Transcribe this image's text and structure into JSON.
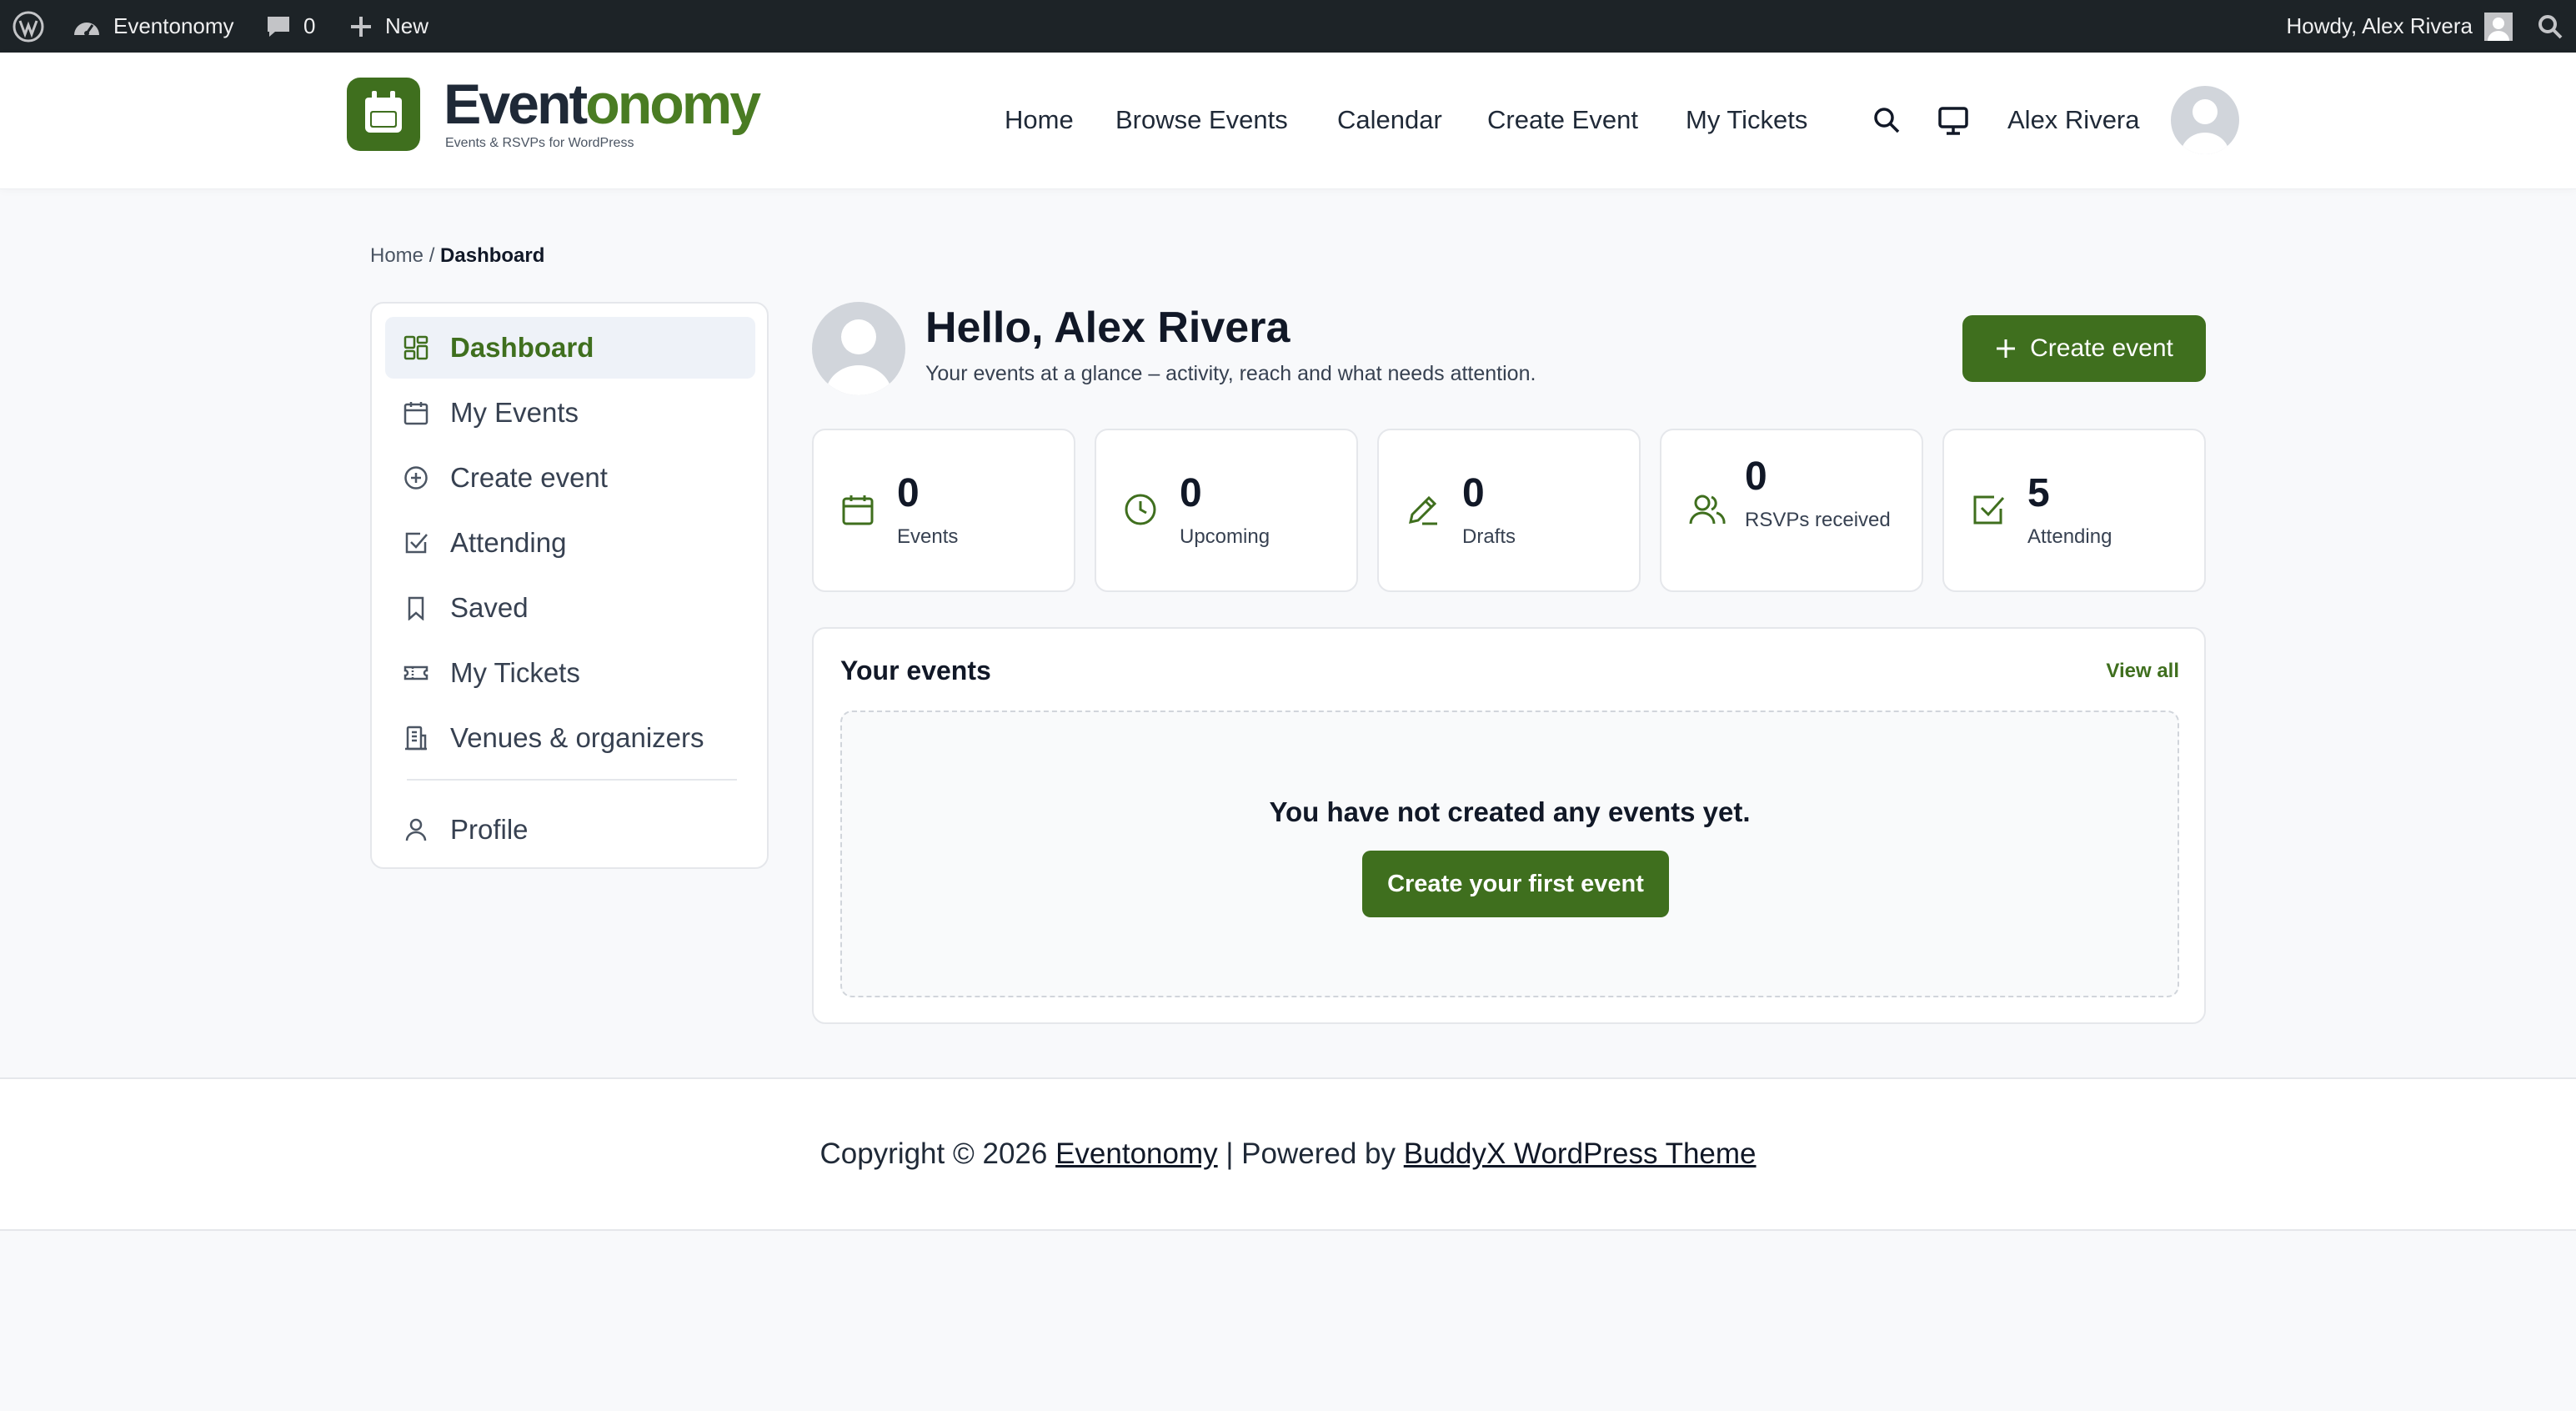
{
  "admin_bar": {
    "site_name": "Eventonomy",
    "comments_count": "0",
    "new_label": "New",
    "howdy": "Howdy, Alex Rivera"
  },
  "header": {
    "logo_part1": "Event",
    "logo_part2": "onomy",
    "tagline": "Events & RSVPs for WordPress",
    "nav": [
      "Home",
      "Browse Events",
      "Calendar",
      "Create Event",
      "My Tickets"
    ],
    "user_name": "Alex Rivera"
  },
  "breadcrumb": {
    "home": "Home",
    "separator": "/",
    "current": "Dashboard"
  },
  "sidebar": {
    "items": [
      {
        "label": "Dashboard",
        "icon": "dashboard-grid-icon"
      },
      {
        "label": "My Events",
        "icon": "calendar-icon"
      },
      {
        "label": "Create event",
        "icon": "plus-circle-icon"
      },
      {
        "label": "Attending",
        "icon": "check-square-icon"
      },
      {
        "label": "Saved",
        "icon": "bookmark-icon"
      },
      {
        "label": "My Tickets",
        "icon": "ticket-icon"
      },
      {
        "label": "Venues & organizers",
        "icon": "building-icon"
      }
    ],
    "profile": {
      "label": "Profile",
      "icon": "user-icon"
    }
  },
  "greeting": {
    "title": "Hello, Alex Rivera",
    "subtitle": "Your events at a glance – activity, reach and what needs attention.",
    "create_button": "Create event"
  },
  "stats": [
    {
      "value": "0",
      "label": "Events",
      "icon": "calendar-icon"
    },
    {
      "value": "0",
      "label": "Upcoming",
      "icon": "clock-icon"
    },
    {
      "value": "0",
      "label": "Drafts",
      "icon": "pencil-icon"
    },
    {
      "value": "0",
      "label": "RSVPs received",
      "icon": "users-icon"
    },
    {
      "value": "5",
      "label": "Attending",
      "icon": "check-square-icon"
    }
  ],
  "your_events": {
    "title": "Your events",
    "view_all": "View all",
    "empty_message": "You have not created any events yet.",
    "empty_button": "Create your first event"
  },
  "footer": {
    "prefix": "Copyright © 2026 ",
    "site_link": "Eventonomy",
    "middle": " | Powered by ",
    "theme_link": "BuddyX WordPress Theme"
  },
  "colors": {
    "accent": "#3f6f1e",
    "admin_bar_bg": "#1d2327",
    "page_bg": "#f8f9fb"
  }
}
